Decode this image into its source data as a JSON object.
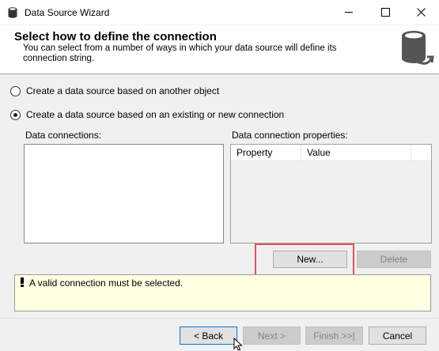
{
  "window": {
    "title": "Data Source Wizard"
  },
  "header": {
    "title": "Select how to define the connection",
    "description": "You can select from a number of ways in which your data source will define its connection string."
  },
  "options": {
    "another_object": "Create a data source based on another object",
    "existing_connection": "Create a data source based on an existing or new connection",
    "selected": "existing_connection"
  },
  "connections": {
    "label": "Data connections:",
    "items": []
  },
  "properties": {
    "label": "Data connection properties:",
    "columns": [
      "Property",
      "Value"
    ]
  },
  "buttons": {
    "new": "New...",
    "delete": "Delete",
    "back": "< Back",
    "next": "Next >",
    "finish": "Finish >>|",
    "cancel": "Cancel"
  },
  "message": "A valid connection must be selected.",
  "colors": {
    "highlight": "#e8505b",
    "message_bg": "#ffffe1",
    "focus_border": "#0078d7"
  },
  "icons": {
    "title": "database-icon",
    "header": "database-arrow-icon",
    "message": "warning-icon"
  }
}
